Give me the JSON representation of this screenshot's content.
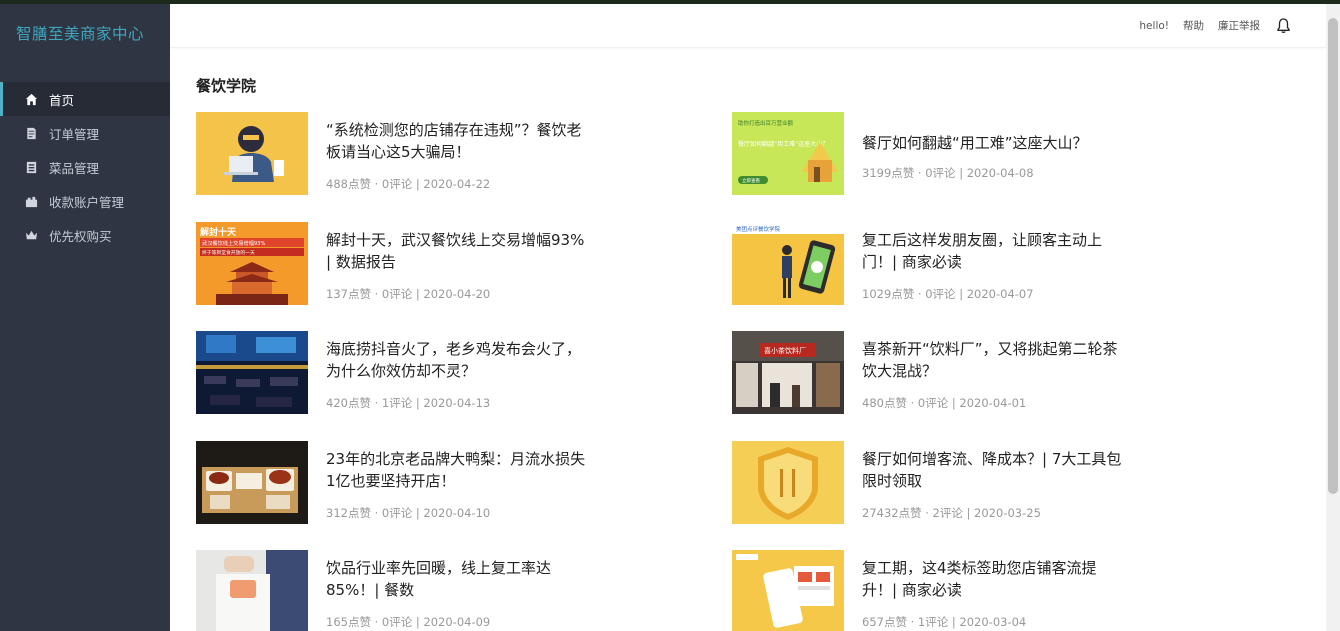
{
  "app": {
    "brand": "智膳至美商家中心"
  },
  "sidebar": {
    "items": [
      {
        "label": "首页",
        "icon": "home-icon"
      },
      {
        "label": "订单管理",
        "icon": "order-icon"
      },
      {
        "label": "菜品管理",
        "icon": "dish-icon"
      },
      {
        "label": "收款账户管理",
        "icon": "wallet-icon"
      },
      {
        "label": "优先权购买",
        "icon": "crown-icon"
      }
    ]
  },
  "header": {
    "hello": "hello!",
    "help": "帮助",
    "report": "廉正举报",
    "bell_icon": "bell-icon"
  },
  "section": {
    "title": "餐饮学院"
  },
  "articles": [
    {
      "title": "“系统检测您的店铺存在违规”？餐饮老板请当心这5大骗局！",
      "meta": "488点赞 · 0评论 | 2020-04-22"
    },
    {
      "title": "餐厅如何翻越“用工难”这座大山？",
      "meta": "3199点赞 · 0评论 | 2020-04-08"
    },
    {
      "title": "解封十天，武汉餐饮线上交易增幅93% | 数据报告",
      "meta": "137点赞 · 0评论 | 2020-04-20"
    },
    {
      "title": "复工后这样发朋友圈，让顾客主动上门！| 商家必读",
      "meta": "1029点赞 · 0评论 | 2020-04-07"
    },
    {
      "title": "海底捞抖音火了，老乡鸡发布会火了，为什么你效仿却不灵？",
      "meta": "420点赞 · 1评论 | 2020-04-13"
    },
    {
      "title": "喜茶新开“饮料厂”，又将挑起第二轮茶饮大混战？",
      "meta": "480点赞 · 0评论 | 2020-04-01"
    },
    {
      "title": "23年的北京老品牌大鸭梨：月流水损失1亿也要坚持开店！",
      "meta": "312点赞 · 0评论 | 2020-04-10"
    },
    {
      "title": "餐厅如何增客流、降成本？| 7大工具包限时领取",
      "meta": "27432点赞 · 2评论 | 2020-03-25"
    },
    {
      "title": "饮品行业率先回暖，线上复工率达85%！| 餐数",
      "meta": "165点赞 · 0评论 | 2020-04-09"
    },
    {
      "title": "复工期，这4类标签助您店铺客流提升！| 商家必读",
      "meta": "657点赞 · 1评论 | 2020-03-04"
    }
  ],
  "thumb_texts": {
    "a1": "助你打造出百万营业额",
    "a1b": "餐厅如何翻越“用工难”这座大山？",
    "a1c": "立即查看",
    "a2": "解封十天",
    "a2b": "武汉餐饮线上交易增幅93%",
    "a2c": "终于等到堂食开放的一天",
    "a3": "美团点评餐饮学院",
    "a5": "喜小茶饮料厂"
  },
  "colors": {
    "sidebar": "#2f3542",
    "brand": "#3fa7bf",
    "accent": "#4fb0c6"
  }
}
